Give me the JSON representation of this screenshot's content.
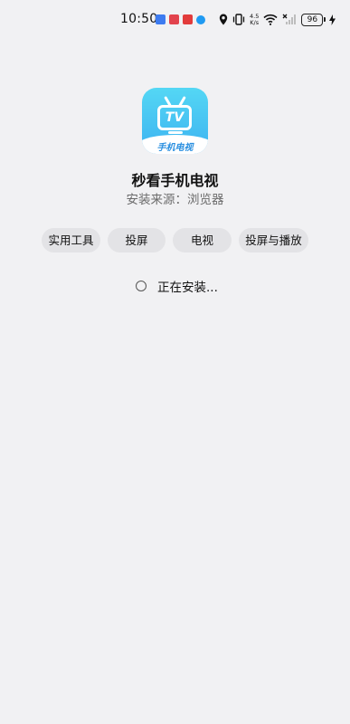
{
  "status_bar": {
    "time": "10:50",
    "net_speed_value": "4.5",
    "net_speed_unit": "K/s",
    "battery_level": "96",
    "colors": {
      "notif_blue": "#3d7bf0",
      "notif_red": "#e2434d",
      "notif_round": "#1f9af2"
    },
    "icons": [
      "notif-app-blue-icon",
      "notif-app-red-icon",
      "notif-app-red-icon",
      "notif-app-round-icon",
      "location-icon",
      "vibrate-icon",
      "wifi-icon",
      "signal-icon",
      "battery-icon",
      "charging-icon"
    ]
  },
  "app": {
    "icon_badge_text": "TV",
    "icon_brand_text": "手机电视",
    "name": "秒看手机电视",
    "source_label": "安装来源",
    "source_separator": "：",
    "source_value": "浏览器",
    "icon_gradient": [
      "#54d7f4",
      "#3cb2f1"
    ]
  },
  "tags": [
    "实用工具",
    "投屏",
    "电视",
    "投屏与播放"
  ],
  "install": {
    "status": "正在安装..."
  }
}
